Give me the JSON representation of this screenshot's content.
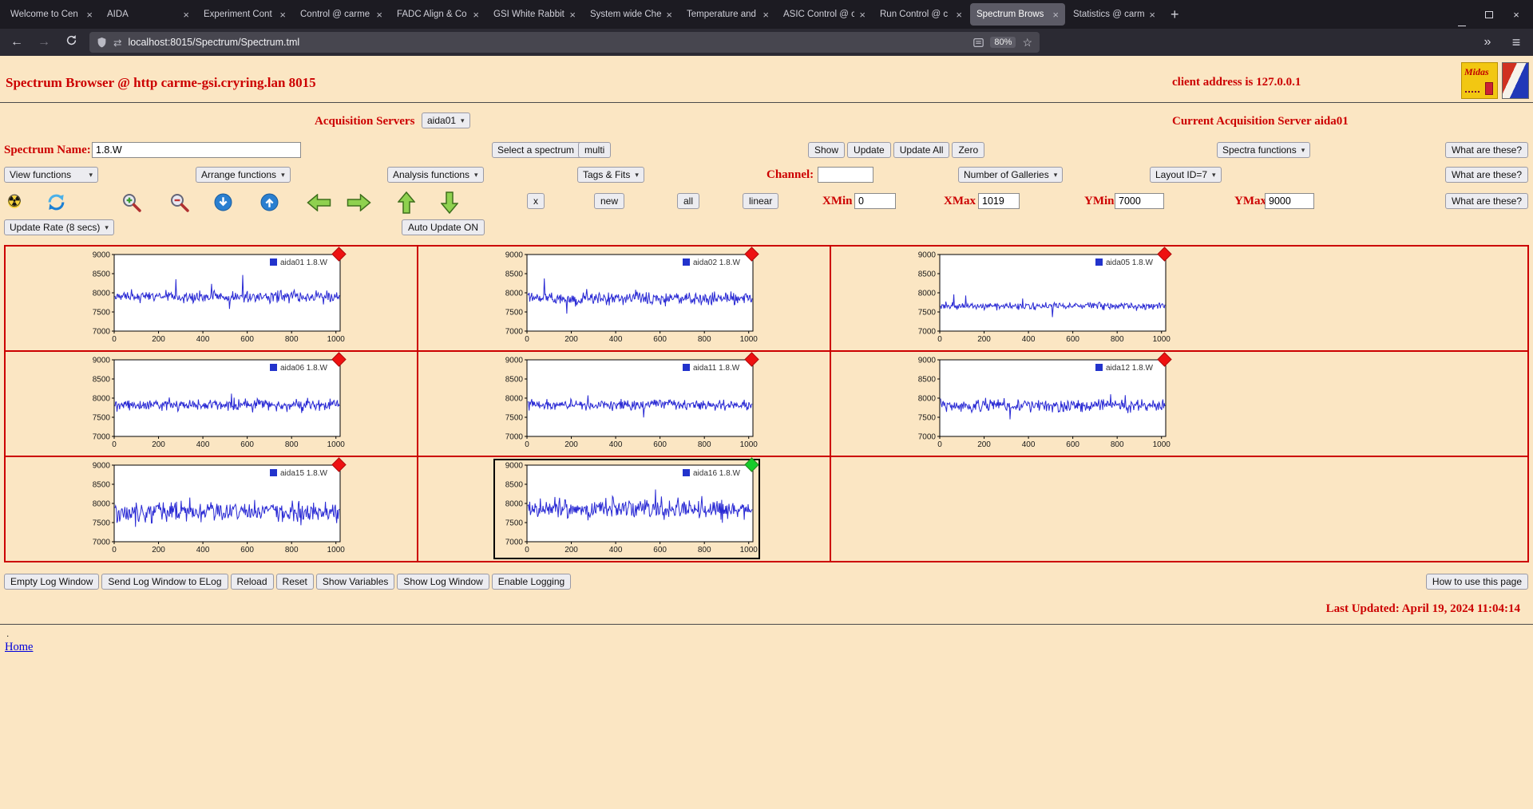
{
  "browser": {
    "tabs": [
      {
        "title": "Welcome to Cen"
      },
      {
        "title": "AIDA"
      },
      {
        "title": "Experiment Cont"
      },
      {
        "title": "Control @ carme"
      },
      {
        "title": "FADC Align & Co"
      },
      {
        "title": "GSI White Rabbit"
      },
      {
        "title": "System wide Che"
      },
      {
        "title": "Temperature and"
      },
      {
        "title": "ASIC Control @ c"
      },
      {
        "title": "Run Control @ c"
      },
      {
        "title": "Spectrum Brows",
        "active": true
      },
      {
        "title": "Statistics @ carm"
      }
    ],
    "new_tab_button": "+",
    "url": "localhost:8015/Spectrum/Spectrum.tml",
    "zoom_badge": "80%",
    "icons": {
      "back": "←",
      "forward": "→",
      "star": "☆",
      "more": "»",
      "menu": "≡",
      "close": "×",
      "connection": "⇄"
    }
  },
  "page": {
    "title": "Spectrum Browser @ http carme-gsi.cryring.lan 8015",
    "client_address": "client address is 127.0.0.1",
    "logo_midas_text": "Midas",
    "acquisition": {
      "label": "Acquisition Servers",
      "server_select": "aida01",
      "current": "Current Acquisition Server aida01"
    },
    "spectrum_row": {
      "name_label": "Spectrum Name:",
      "name_value": "1.8.W",
      "select_spectrum": "Select a spectrum",
      "multi": "multi",
      "show": "Show",
      "update": "Update",
      "update_all": "Update All",
      "zero": "Zero",
      "spectra_functions": "Spectra functions",
      "what_are_these": "What are these?"
    },
    "functions_row": {
      "view_functions": "View functions",
      "arrange_functions": "Arrange functions",
      "analysis_functions": "Analysis functions",
      "tags_fits": "Tags & Fits",
      "channel_label": "Channel:",
      "channel_value": "",
      "galleries_select": "Number of Galleries",
      "layout_select": "Layout ID=7",
      "what_are_these": "What are these?"
    },
    "axis_row": {
      "radiation_icon": "☢",
      "x_button": "x",
      "new_button": "new",
      "all_button": "all",
      "linear_button": "linear",
      "xmin_label": "XMin",
      "xmin": "0",
      "xmax_label": "XMax",
      "xmax": "1019",
      "ymin_label": "YMin",
      "ymin": "7000",
      "ymax_label": "YMax",
      "ymax": "9000",
      "what_are_these": "What are these?"
    },
    "update_row": {
      "update_rate": "Update Rate (8 secs)",
      "auto_update": "Auto Update ON"
    },
    "footer": {
      "buttons": [
        "Empty Log Window",
        "Send Log Window to ELog",
        "Reload",
        "Reset",
        "Show Variables",
        "Show Log Window",
        "Enable Logging"
      ],
      "help_button": "How to use this page",
      "last_updated": "Last Updated: April 19, 2024 11:04:14",
      "stray_dot": ".",
      "home_link": "Home"
    }
  },
  "chart_data": {
    "type": "line",
    "layout": "3x3-gallery",
    "x_ticks": [
      0,
      200,
      400,
      600,
      800,
      1000
    ],
    "y_ticks": [
      7000,
      7500,
      8000,
      8500,
      9000
    ],
    "x_range": [
      0,
      1019
    ],
    "y_range": [
      7000,
      9000
    ],
    "grid": false,
    "legend_position": "top-right",
    "line_color": "#2a2ad4",
    "plots": [
      {
        "legend": "aida01 1.8.W",
        "marker": "red",
        "baseline": 7900,
        "noise": 90,
        "selected": false
      },
      {
        "legend": "aida02 1.8.W",
        "marker": "red",
        "baseline": 7850,
        "noise": 95,
        "selected": false
      },
      {
        "legend": "aida05 1.8.W",
        "marker": "red",
        "baseline": 7650,
        "noise": 55,
        "selected": false
      },
      {
        "legend": "aida06 1.8.W",
        "marker": "red",
        "baseline": 7820,
        "noise": 90,
        "selected": false
      },
      {
        "legend": "aida11 1.8.W",
        "marker": "red",
        "baseline": 7820,
        "noise": 80,
        "selected": false
      },
      {
        "legend": "aida12 1.8.W",
        "marker": "red",
        "baseline": 7800,
        "noise": 95,
        "selected": false
      },
      {
        "legend": "aida15 1.8.W",
        "marker": "red",
        "baseline": 7780,
        "noise": 150,
        "selected": false
      },
      {
        "legend": "aida16 1.8.W",
        "marker": "green",
        "baseline": 7850,
        "noise": 150,
        "selected": true
      },
      null
    ]
  },
  "colors": {
    "page_bg": "#FBE6C3",
    "accent_red": "#CC0000",
    "grid_border": "#CC0000",
    "marker_red": "#EE1111",
    "marker_green": "#17CC2A",
    "legend_square": "#2233CC"
  }
}
